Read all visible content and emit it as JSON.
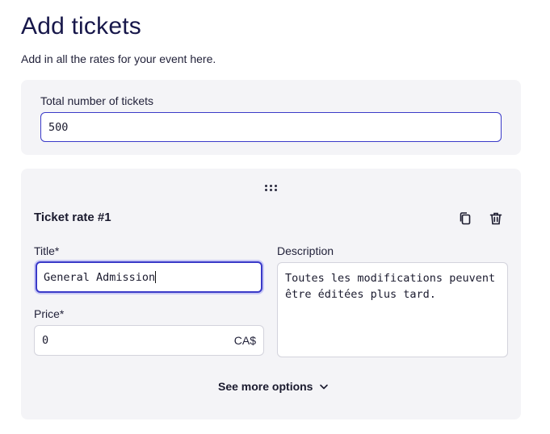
{
  "page": {
    "title": "Add tickets",
    "subtitle": "Add in all the rates for your event here."
  },
  "total": {
    "label": "Total number of tickets",
    "value": "500"
  },
  "rate": {
    "heading": "Ticket rate #1",
    "title_label": "Title*",
    "title_value": "General Admission",
    "price_label": "Price*",
    "price_value": "0",
    "currency": "CA$",
    "description_label": "Description",
    "description_value": "Toutes les modifications peuvent être éditées plus tard.",
    "more_options": "See more options"
  },
  "icons": {
    "drag": "drag-handle-icon",
    "duplicate": "copy-icon",
    "delete": "trash-icon",
    "expand": "chevron-down-icon"
  },
  "colors": {
    "accent": "#3a3ac8",
    "title": "#17174a",
    "panel": "#f4f4f7"
  }
}
